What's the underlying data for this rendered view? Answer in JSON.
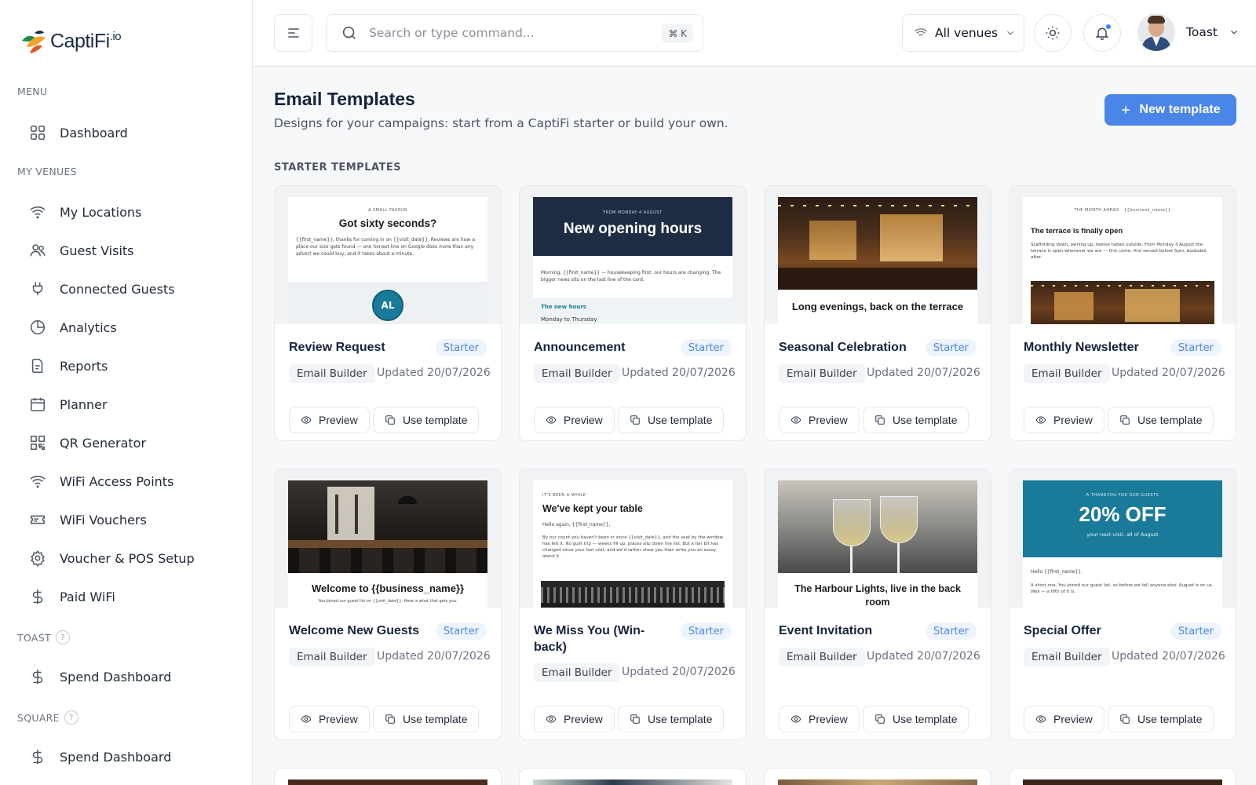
{
  "brand": {
    "name": "CaptiFi",
    "suffix": ".io"
  },
  "sidebar": {
    "menu_label": "MENU",
    "dashboard": "Dashboard",
    "venues_label": "MY VENUES",
    "items": [
      {
        "label": "My Locations",
        "icon": "wifi-icon"
      },
      {
        "label": "Guest Visits",
        "icon": "users-icon"
      },
      {
        "label": "Connected Guests",
        "icon": "plug-icon"
      },
      {
        "label": "Analytics",
        "icon": "pie-chart-icon"
      },
      {
        "label": "Reports",
        "icon": "document-icon"
      },
      {
        "label": "Planner",
        "icon": "calendar-icon"
      },
      {
        "label": "QR Generator",
        "icon": "qr-code-icon"
      },
      {
        "label": "WiFi Access Points",
        "icon": "wifi-icon"
      },
      {
        "label": "WiFi Vouchers",
        "icon": "ticket-icon"
      },
      {
        "label": "Voucher & POS Setup",
        "icon": "gear-icon"
      },
      {
        "label": "Paid WiFi",
        "icon": "dollar-icon"
      }
    ],
    "toast_label": "TOAST",
    "toast_item": "Spend Dashboard",
    "square_label": "SQUARE",
    "square_item": "Spend Dashboard",
    "help_glyph": "?"
  },
  "topbar": {
    "search_placeholder": "Search or type command...",
    "shortcut": "⌘ K",
    "venue_select": "All venues",
    "user_name": "Toast"
  },
  "page": {
    "title": "Email Templates",
    "subtitle": "Designs for your campaigns: start from a CaptiFi starter or build your own.",
    "new_button": "New template",
    "section_title": "STARTER TEMPLATES"
  },
  "card_common": {
    "badge": "Starter",
    "tag": "Email Builder",
    "updated": "Updated 20/07/2026",
    "preview": "Preview",
    "use": "Use template"
  },
  "templates": [
    {
      "name": "Review Request",
      "thumb": {
        "kicker": "A SMALL FAVOUR",
        "title": "Got sixty seconds?",
        "body": "{{first_name}}, thanks for coming in on {{visit_date}}. Reviews are how a place our size gets found — one honest line on Google does more than any advert we could buy, and it takes about a minute.",
        "initials": "AL"
      }
    },
    {
      "name": "Announcement",
      "thumb": {
        "kicker": "FROM MONDAY 4 AUGUST",
        "title": "New opening hours",
        "body": "Morning, {{first_name}} — housekeeping first: our hours are changing. The bigger news sits on the last line of the card.",
        "sub": "The new hours",
        "sub2": "Monday to Thursday"
      }
    },
    {
      "name": "Seasonal Celebration",
      "thumb": {
        "title": "Long evenings, back on the terrace"
      }
    },
    {
      "name": "Monthly Newsletter",
      "thumb": {
        "kicker": "THE MONTH AHEAD · {{business_name}}",
        "title": "The terrace is finally open",
        "body": "Scaffolding down, awning up, twelve tables outside. From Monday 3 August the terrace is open whenever we are — first come, first served before 5pm, bookable after."
      }
    },
    {
      "name": "Welcome New Guests",
      "thumb": {
        "title": "Welcome to {{business_name}}",
        "body": "You joined our guest list on {{visit_date}}. Here is what that gets you."
      }
    },
    {
      "name": "We Miss You (Win-back)",
      "thumb": {
        "kicker": "IT'S BEEN A WHILE",
        "title": "We've kept your table",
        "greeting": "Hello again, {{first_name}},",
        "body": "By our count you haven't been in since {{visit_date}}, and the seat by the window has felt it. No guilt trip — weeks fill up, places slip down the list. But a fair bit has changed since your last visit, and we'd rather show you than write you an essay about it."
      }
    },
    {
      "name": "Event Invitation",
      "thumb": {
        "title": "The Harbour Lights, live in the back room"
      }
    },
    {
      "name": "Special Offer",
      "thumb": {
        "kicker": "A THANK-YOU FOR OUR GUESTS",
        "title": "20% OFF",
        "sub": "your next visit, all of August",
        "greeting": "Hello {{first_name}},",
        "body": "A short one. You joined our guest list, so before we tell anyone else: August is on us. Well — a fifth of it is."
      }
    }
  ],
  "colors": {
    "accent": "#4a86e8",
    "navy": "#1f2d44",
    "teal": "#1a7a99",
    "badge_bg": "#eef4fd"
  }
}
